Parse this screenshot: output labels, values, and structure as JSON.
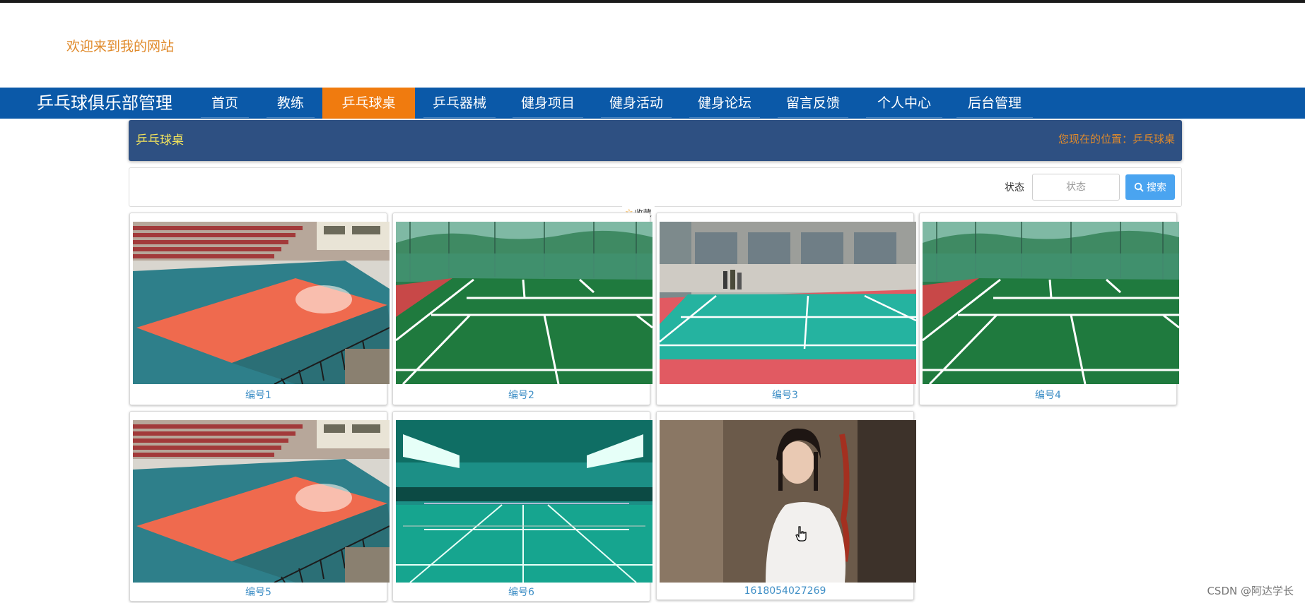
{
  "header": {
    "welcome_text": "欢迎来到我的网站"
  },
  "nav": {
    "brand": "乒乓球俱乐部管理",
    "items": [
      {
        "label": "首页"
      },
      {
        "label": "教练"
      },
      {
        "label": "乒乓球桌",
        "active": true
      },
      {
        "label": "乒乓器械"
      },
      {
        "label": "健身项目"
      },
      {
        "label": "健身活动"
      },
      {
        "label": "健身论坛"
      },
      {
        "label": "留言反馈"
      },
      {
        "label": "个人中心"
      },
      {
        "label": "后台管理"
      }
    ]
  },
  "breadcrumb": {
    "title": "乒乓球桌",
    "location": "您现在的位置：乒乓球桌"
  },
  "search": {
    "status_label": "状态",
    "status_placeholder": "状态",
    "button_label": "搜索"
  },
  "favorite": {
    "label": "收藏"
  },
  "cards": [
    {
      "caption": "编号1",
      "image": "volleyball-court-photo"
    },
    {
      "caption": "编号2",
      "image": "green-tennis-court-photo"
    },
    {
      "caption": "编号3",
      "image": "teal-court-building-photo"
    },
    {
      "caption": "编号4",
      "image": "green-tennis-court-photo"
    },
    {
      "caption": "编号5",
      "image": "volleyball-court-photo"
    },
    {
      "caption": "编号6",
      "image": "indoor-badminton-hall-photo"
    },
    {
      "caption": "1618054027269",
      "image": "portrait-woman-white-dress-photo"
    }
  ],
  "footer": {
    "watermark": "CSDN @阿达学长"
  },
  "colors": {
    "nav_bg": "#0b59a8",
    "nav_active": "#f07b0f",
    "crumb_bg": "#2e5082",
    "accent_orange": "#e08a2b",
    "button_blue": "#4aa4f0",
    "caption_blue": "#3f8fc6"
  }
}
